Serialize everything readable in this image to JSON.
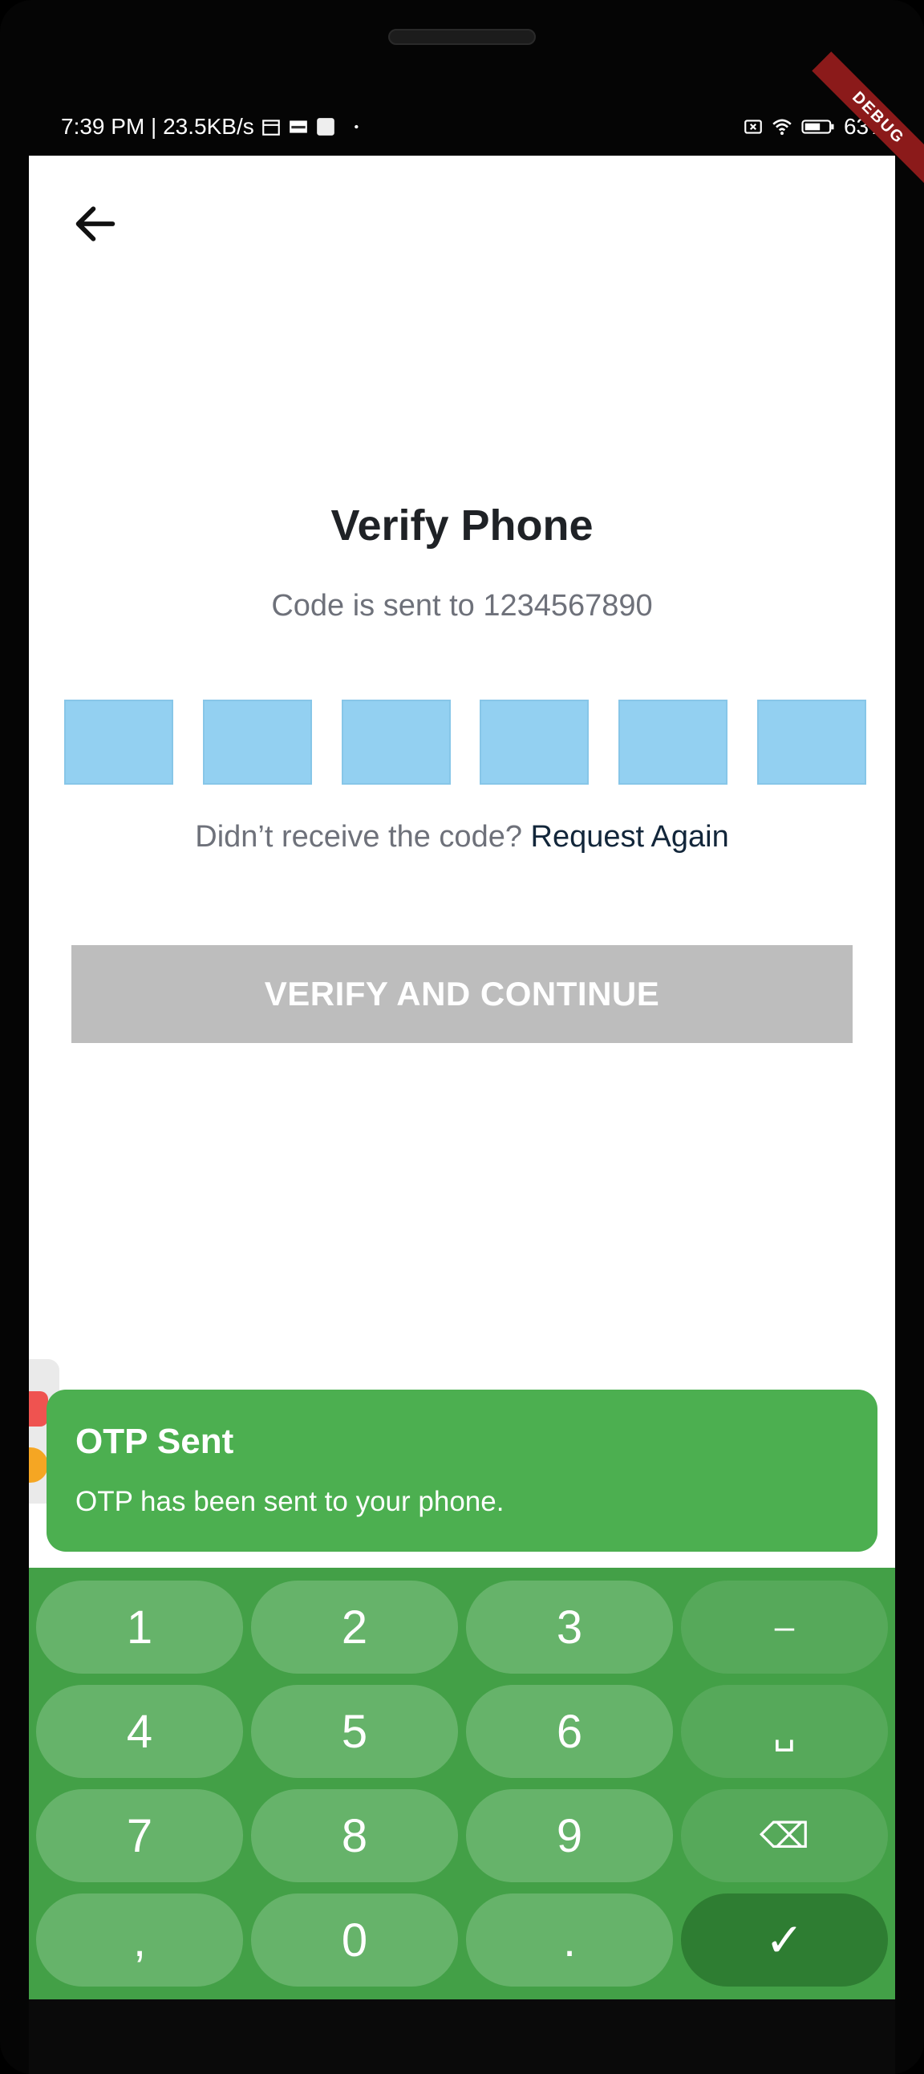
{
  "status_bar": {
    "time_speed": "7:39 PM | 23.5KB/s",
    "battery": "63%",
    "debug_label": "DEBUG",
    "icons": [
      "calendar-icon",
      "app-icon",
      "square-icon",
      "dot-icon",
      "sim-off-icon",
      "wifi-icon",
      "battery-icon"
    ]
  },
  "header": {
    "back_icon": "arrow-left-icon"
  },
  "verify": {
    "title": "Verify Phone",
    "subtitle": "Code is sent to 1234567890",
    "otp_digits": [
      "",
      "",
      "",
      "",
      "",
      ""
    ],
    "resend_prompt": "Didn’t receive the code?",
    "resend_link": "Request Again",
    "button_label": "VERIFY AND CONTINUE"
  },
  "toast": {
    "title": "OTP Sent",
    "message": "OTP has been sent to your phone."
  },
  "keyboard": {
    "keys": [
      {
        "label": "1"
      },
      {
        "label": "2"
      },
      {
        "label": "3"
      },
      {
        "label": "–",
        "type": "fn"
      },
      {
        "label": "4"
      },
      {
        "label": "5"
      },
      {
        "label": "6"
      },
      {
        "label": "␣",
        "type": "fn"
      },
      {
        "label": "7"
      },
      {
        "label": "8"
      },
      {
        "label": "9"
      },
      {
        "label": "⌫",
        "type": "fn"
      },
      {
        "label": ","
      },
      {
        "label": "0"
      },
      {
        "label": "."
      },
      {
        "label": "✓",
        "type": "done"
      }
    ]
  },
  "colors": {
    "otp_box": "#93d0f1",
    "button_disabled": "#bdbdbd",
    "toast_bg": "#4caf50",
    "keyboard_bg": "#43a047"
  }
}
